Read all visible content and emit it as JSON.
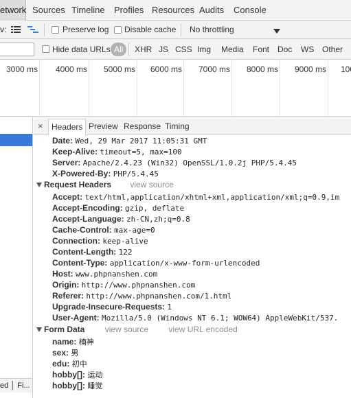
{
  "main_tabs": [
    "etwork",
    "Sources",
    "Timeline",
    "Profiles",
    "Resources",
    "Audits",
    "Console"
  ],
  "toolbar": {
    "view_label": "v:",
    "preserve_log": "Preserve log",
    "disable_cache": "Disable cache",
    "throttle_value": "No throttling"
  },
  "filter_bar": {
    "hide_data_urls": "Hide data URLs",
    "types": [
      "All",
      "XHR",
      "JS",
      "CSS",
      "Img",
      "Media",
      "Font",
      "Doc",
      "WS",
      "Other"
    ]
  },
  "timeline_ticks": [
    "3000 ms",
    "4000 ms",
    "5000 ms",
    "6000 ms",
    "7000 ms",
    "8000 ms",
    "9000 ms",
    "100"
  ],
  "status_text": "ed │ Fi...",
  "detail_tabs": [
    "Headers",
    "Preview",
    "Response",
    "Timing"
  ],
  "response_headers": [
    {
      "key": "Date:",
      "value": "Wed, 29 Mar 2017 11:05:31 GMT"
    },
    {
      "key": "Keep-Alive:",
      "value": "timeout=5, max=100"
    },
    {
      "key": "Server:",
      "value": "Apache/2.4.23 (Win32) OpenSSL/1.0.2j PHP/5.4.45"
    },
    {
      "key": "X-Powered-By:",
      "value": "PHP/5.4.45"
    }
  ],
  "request_section": {
    "title": "Request Headers",
    "link": "view source"
  },
  "request_headers": [
    {
      "key": "Accept:",
      "value": "text/html,application/xhtml+xml,application/xml;q=0.9,im"
    },
    {
      "key": "Accept-Encoding:",
      "value": "gzip, deflate"
    },
    {
      "key": "Accept-Language:",
      "value": "zh-CN,zh;q=0.8"
    },
    {
      "key": "Cache-Control:",
      "value": "max-age=0"
    },
    {
      "key": "Connection:",
      "value": "keep-alive"
    },
    {
      "key": "Content-Length:",
      "value": "122"
    },
    {
      "key": "Content-Type:",
      "value": "application/x-www-form-urlencoded"
    },
    {
      "key": "Host:",
      "value": "www.phpnanshen.com"
    },
    {
      "key": "Origin:",
      "value": "http://www.phpnanshen.com"
    },
    {
      "key": "Referer:",
      "value": "http://www.phpnanshen.com/1.html"
    },
    {
      "key": "Upgrade-Insecure-Requests:",
      "value": "1"
    },
    {
      "key": "User-Agent:",
      "value": "Mozilla/5.0 (Windows NT 6.1; WOW64) AppleWebKit/537."
    }
  ],
  "form_section": {
    "title": "Form Data",
    "link1": "view source",
    "link2": "view URL encoded"
  },
  "form_data": [
    {
      "key": "name:",
      "value": "楠神"
    },
    {
      "key": "sex:",
      "value": "男"
    },
    {
      "key": "edu:",
      "value": "初中"
    },
    {
      "key": "hobby[]:",
      "value": "运动"
    },
    {
      "key": "hobby[]:",
      "value": "睡觉"
    }
  ]
}
